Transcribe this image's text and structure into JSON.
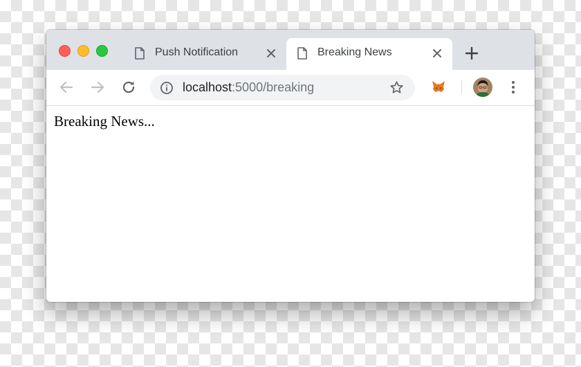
{
  "tabs": [
    {
      "title": "Push Notification",
      "active": false
    },
    {
      "title": "Breaking News",
      "active": true
    }
  ],
  "toolbar": {
    "url_host": "localhost",
    "url_path": ":5000/breaking",
    "icons": [
      "back-arrow-icon",
      "forward-arrow-icon",
      "reload-icon",
      "info-icon",
      "star-icon",
      "metamask-fox-icon",
      "avatar",
      "more-vert-icon"
    ]
  },
  "page": {
    "text": "Breaking News..."
  },
  "colors": {
    "tabstrip": "#dee1e6",
    "omnibox": "#f1f3f4",
    "traffic_close": "#ff5f57",
    "traffic_minimize": "#febc2e",
    "traffic_maximize": "#28c840"
  }
}
